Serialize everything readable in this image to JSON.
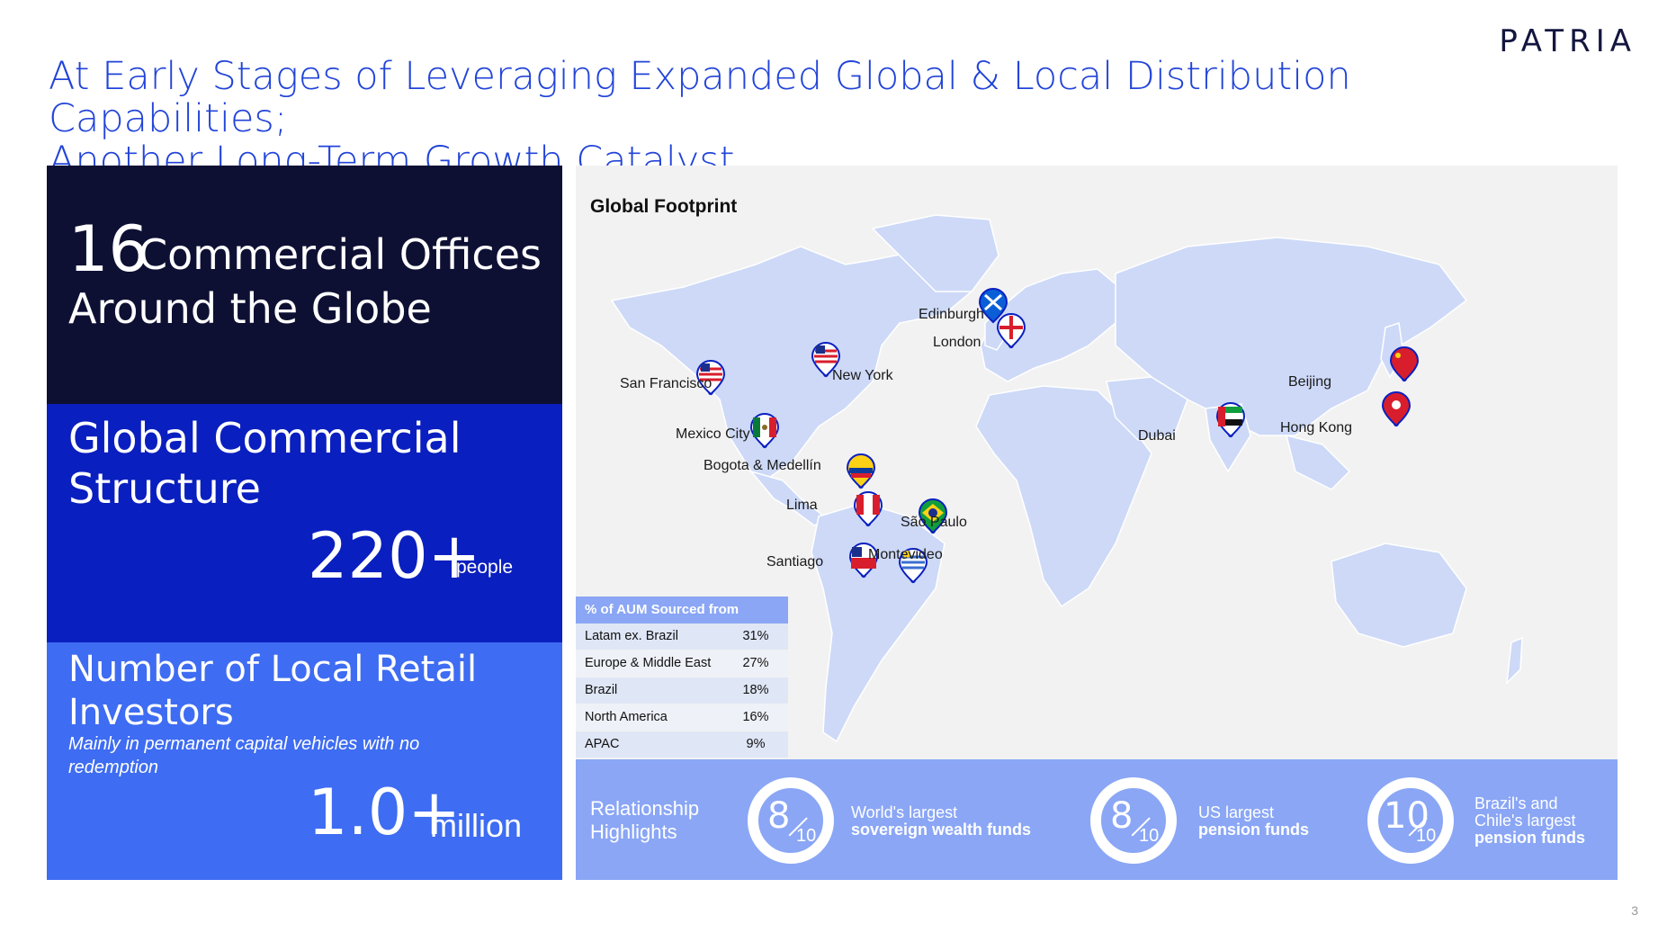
{
  "logo": "PATRIA",
  "title_line1": "At Early Stages of Leveraging Expanded Global & Local Distribution Capabilities;",
  "title_line2": "Another Long-Term Growth Catalyst",
  "offices": {
    "number": "16",
    "line1": "Commercial Offices",
    "line2": "Around the Globe"
  },
  "structure": {
    "heading": "Global Commercial Structure",
    "number": "220+",
    "unit": "people"
  },
  "investors": {
    "heading": "Number of Local Retail Investors",
    "subtext": "Mainly in permanent capital vehicles with no redemption",
    "number": "1.0+",
    "unit": "million"
  },
  "footprint_label": "Global Footprint",
  "cities": [
    "Edinburgh",
    "London",
    "San Francisco",
    "New York",
    "Mexico City",
    "Bogota & Medellín",
    "Lima",
    "Santiago",
    "São Paulo",
    "Montevideo",
    "Dubai",
    "Beijing",
    "Hong Kong"
  ],
  "aum": {
    "header": "% of AUM Sourced from",
    "rows": [
      {
        "region": "Latam ex. Brazil",
        "pct": "31%"
      },
      {
        "region": "Europe & Middle East",
        "pct": "27%"
      },
      {
        "region": "Brazil",
        "pct": "18%"
      },
      {
        "region": "North America",
        "pct": "16%"
      },
      {
        "region": "APAC",
        "pct": "9%"
      }
    ]
  },
  "highlights": {
    "label_line1": "Relationship",
    "label_line2": "Highlights",
    "items": [
      {
        "value": "8",
        "of": "10",
        "line1": "World's largest",
        "line2": "sovereign wealth funds",
        "line3": ""
      },
      {
        "value": "8",
        "of": "10",
        "line1": "US largest",
        "line2": "pension funds",
        "line3": ""
      },
      {
        "value": "10",
        "of": "10",
        "line1": "Brazil's and",
        "line2": "Chile's largest",
        "line3": "pension funds"
      }
    ]
  },
  "page_number": "3",
  "colors": {
    "navy": "#0e1033",
    "royal_blue": "#0a1fbf",
    "bright_blue": "#3e6cf2",
    "light_blue": "#8aa6f5",
    "title_blue": "#2244d8",
    "map_land": "#cdd9f7"
  },
  "flag_icons": [
    "scotland-flag-icon",
    "england-flag-icon",
    "usa-flag-icon",
    "mexico-flag-icon",
    "colombia-flag-icon",
    "peru-flag-icon",
    "brazil-flag-icon",
    "chile-flag-icon",
    "uruguay-flag-icon",
    "uae-flag-icon",
    "china-flag-icon",
    "hong-kong-flag-icon"
  ]
}
